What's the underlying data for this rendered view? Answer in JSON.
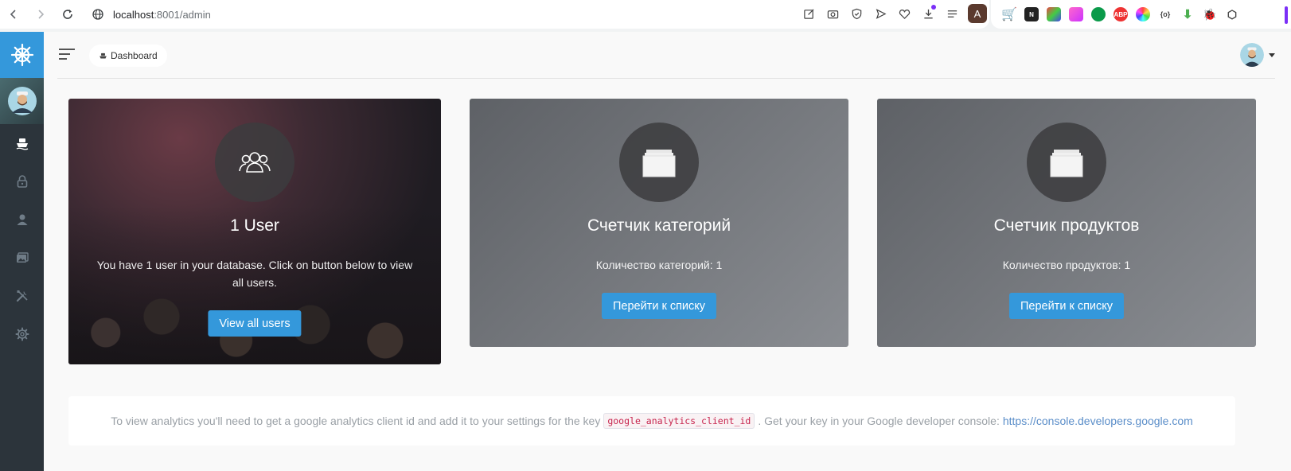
{
  "browser": {
    "url_host": "localhost",
    "url_path": ":8001/admin",
    "profile_initial": "A"
  },
  "header": {
    "breadcrumb": "Dashboard"
  },
  "cards": {
    "users": {
      "title": "1 User",
      "text": "You have 1 user in your database. Click on button below to view all users.",
      "button": "View all users"
    },
    "categories": {
      "title": "Счетчик категорий",
      "text": "Количество категорий: 1",
      "button": "Перейти к списку"
    },
    "products": {
      "title": "Счетчик продуктов",
      "text": "Количество продуктов: 1",
      "button": "Перейти к списку"
    }
  },
  "notice": {
    "text_before": "To view analytics you'll need to get a google analytics client id and add it to your settings for the key",
    "code": "google_analytics_client_id",
    "text_after": ". Get your key in your Google developer console:",
    "link": "https://console.developers.google.com"
  },
  "colors": {
    "accent": "#3498db",
    "sidebar": "#2c343b"
  }
}
